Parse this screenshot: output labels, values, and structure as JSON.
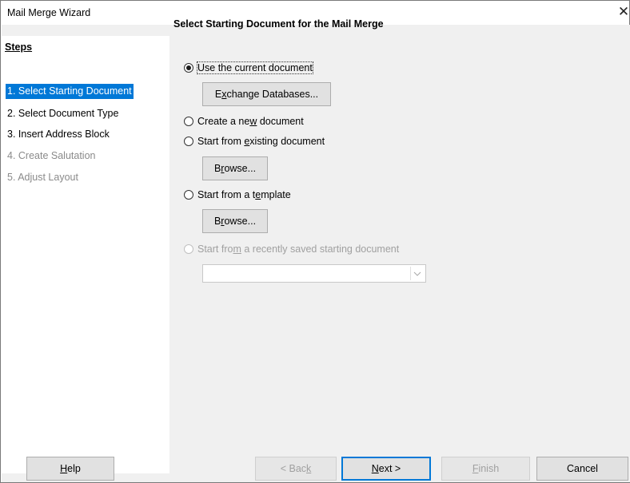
{
  "window": {
    "title": "Mail Merge Wizard",
    "close_glyph": "✕"
  },
  "steps": {
    "heading": "Steps",
    "items": [
      {
        "label": "1. Select Starting Document",
        "state": "active"
      },
      {
        "label": "2. Select Document Type",
        "state": "enabled"
      },
      {
        "label": "3. Insert Address Block",
        "state": "enabled"
      },
      {
        "label": "4. Create Salutation",
        "state": "disabled"
      },
      {
        "label": "5. Adjust Layout",
        "state": "disabled"
      }
    ]
  },
  "main": {
    "heading": "Select Starting Document for the Mail Merge",
    "options": {
      "current": {
        "label": "Use the current document",
        "checked": true
      },
      "new": {
        "pre": "Create a ne",
        "mn": "w",
        "post": " document",
        "checked": false
      },
      "existing": {
        "pre": "Start from ",
        "mn": "e",
        "post": "xisting document",
        "checked": false
      },
      "template": {
        "pre": "Start from a t",
        "mn": "e",
        "post": "mplate",
        "checked": false
      },
      "recent": {
        "pre": "Start fro",
        "mn": "m",
        "post": " a recently saved starting document",
        "checked": false,
        "disabled": true
      }
    },
    "exchange_button": {
      "pre": "E",
      "mn": "x",
      "post": "change Databases..."
    },
    "browse_button_1": {
      "pre": "B",
      "mn": "r",
      "post": "owse..."
    },
    "browse_button_2": {
      "pre": "B",
      "mn": "r",
      "post": "owse..."
    },
    "recent_combo": {
      "value": "",
      "arrow_icon": "chevron-down"
    }
  },
  "footer": {
    "help": {
      "pre": "",
      "mn": "H",
      "post": "elp"
    },
    "back": {
      "pre": "< Bac",
      "mn": "k",
      "post": "",
      "disabled": true
    },
    "next": {
      "pre": "",
      "mn": "N",
      "post": "ext >",
      "default": true
    },
    "finish": {
      "pre": "",
      "mn": "F",
      "post": "inish",
      "disabled": true
    },
    "cancel": {
      "label": "Cancel"
    }
  }
}
